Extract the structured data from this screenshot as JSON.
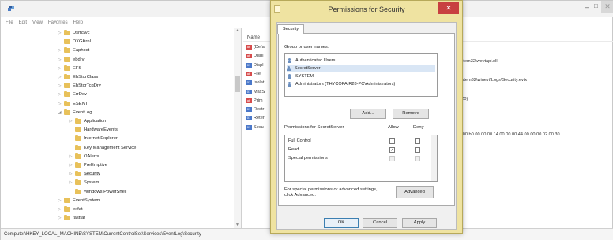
{
  "registry": {
    "menu": [
      "File",
      "Edit",
      "View",
      "Favorites",
      "Help"
    ],
    "window_controls": {
      "minimize": "–",
      "maximize": "□",
      "close": "✕"
    },
    "tree": [
      {
        "label": "DsmSvc",
        "indent": 2,
        "arrow": "▷"
      },
      {
        "label": "DXGKrnl",
        "indent": 2,
        "arrow": ""
      },
      {
        "label": "Eaphost",
        "indent": 2,
        "arrow": "▷"
      },
      {
        "label": "ebdrv",
        "indent": 2,
        "arrow": "▷"
      },
      {
        "label": "EFS",
        "indent": 2,
        "arrow": "▷"
      },
      {
        "label": "EhStorClass",
        "indent": 2,
        "arrow": "▷"
      },
      {
        "label": "EhStorTcgDrv",
        "indent": 2,
        "arrow": "▷"
      },
      {
        "label": "ErrDev",
        "indent": 2,
        "arrow": "▷"
      },
      {
        "label": "ESENT",
        "indent": 2,
        "arrow": "▷"
      },
      {
        "label": "EventLog",
        "indent": 2,
        "arrow": "◢"
      },
      {
        "label": "Application",
        "indent": 3,
        "arrow": "▷"
      },
      {
        "label": "HardwareEvents",
        "indent": 3,
        "arrow": ""
      },
      {
        "label": "Internet Explorer",
        "indent": 3,
        "arrow": ""
      },
      {
        "label": "Key Management Service",
        "indent": 3,
        "arrow": ""
      },
      {
        "label": "OAlerts",
        "indent": 3,
        "arrow": "▷"
      },
      {
        "label": "PreEmptive",
        "indent": 3,
        "arrow": "▷"
      },
      {
        "label": "Security",
        "indent": 3,
        "arrow": "▷",
        "selected": true
      },
      {
        "label": "System",
        "indent": 3,
        "arrow": "▷"
      },
      {
        "label": "Windows PowerShell",
        "indent": 3,
        "arrow": ""
      },
      {
        "label": "EventSystem",
        "indent": 2,
        "arrow": "▷"
      },
      {
        "label": "exfat",
        "indent": 2,
        "arrow": "▷"
      },
      {
        "label": "fastfat",
        "indent": 2,
        "arrow": "▷"
      }
    ],
    "values_header": "Name",
    "values": [
      {
        "name": "(Defa",
        "type": "ab"
      },
      {
        "name": "Displ",
        "type": "ab"
      },
      {
        "name": "Displ",
        "type": "bin"
      },
      {
        "name": "File",
        "type": "ab"
      },
      {
        "name": "Isolat",
        "type": "bin"
      },
      {
        "name": "MaxS",
        "type": "bin"
      },
      {
        "name": "Prim",
        "type": "ab"
      },
      {
        "name": "Restr",
        "type": "bin"
      },
      {
        "name": "Reter",
        "type": "bin"
      },
      {
        "name": "Secu",
        "type": "bin"
      }
    ],
    "data_column": [
      "system32\\wevtapi.dll",
      "System32\\winevt\\Logs\\Security.evtx",
      "7520)",
      "00 00 b0 00 00 00 14 00 00 00 44 00 00 00 02 00 30 ..."
    ],
    "status_path": "Computer\\HKEY_LOCAL_MACHINE\\SYSTEM\\CurrentControlSet\\Services\\EventLog\\Security"
  },
  "dialog": {
    "title": "Permissions for Security",
    "close": "✕",
    "tab": "Security",
    "group_label": "Group or user names:",
    "users": [
      "Authenticated Users",
      "SecretServer",
      "SYSTEM",
      "Administrators (THYCOPAIR28-PC\\Administrators)"
    ],
    "selected_user_index": 1,
    "add_button": "Add...",
    "remove_button": "Remove",
    "perm_for_label": "Permissions for SecretServer",
    "allow_header": "Allow",
    "deny_header": "Deny",
    "permissions": [
      {
        "name": "Full Control",
        "allow": false,
        "deny": false,
        "disabled": false
      },
      {
        "name": "Read",
        "allow": true,
        "deny": false,
        "disabled": false
      },
      {
        "name": "Special permissions",
        "allow": false,
        "deny": false,
        "disabled": true
      }
    ],
    "special_text_line1": "For special permissions or advanced settings,",
    "special_text_line2": "click Advanced.",
    "advanced_button": "Advanced",
    "ok_button": "OK",
    "cancel_button": "Cancel",
    "apply_button": "Apply",
    "colors": {
      "title_bg": "#efe3a1",
      "close_bg": "#c84040",
      "selection": "#d9e6f5"
    }
  }
}
